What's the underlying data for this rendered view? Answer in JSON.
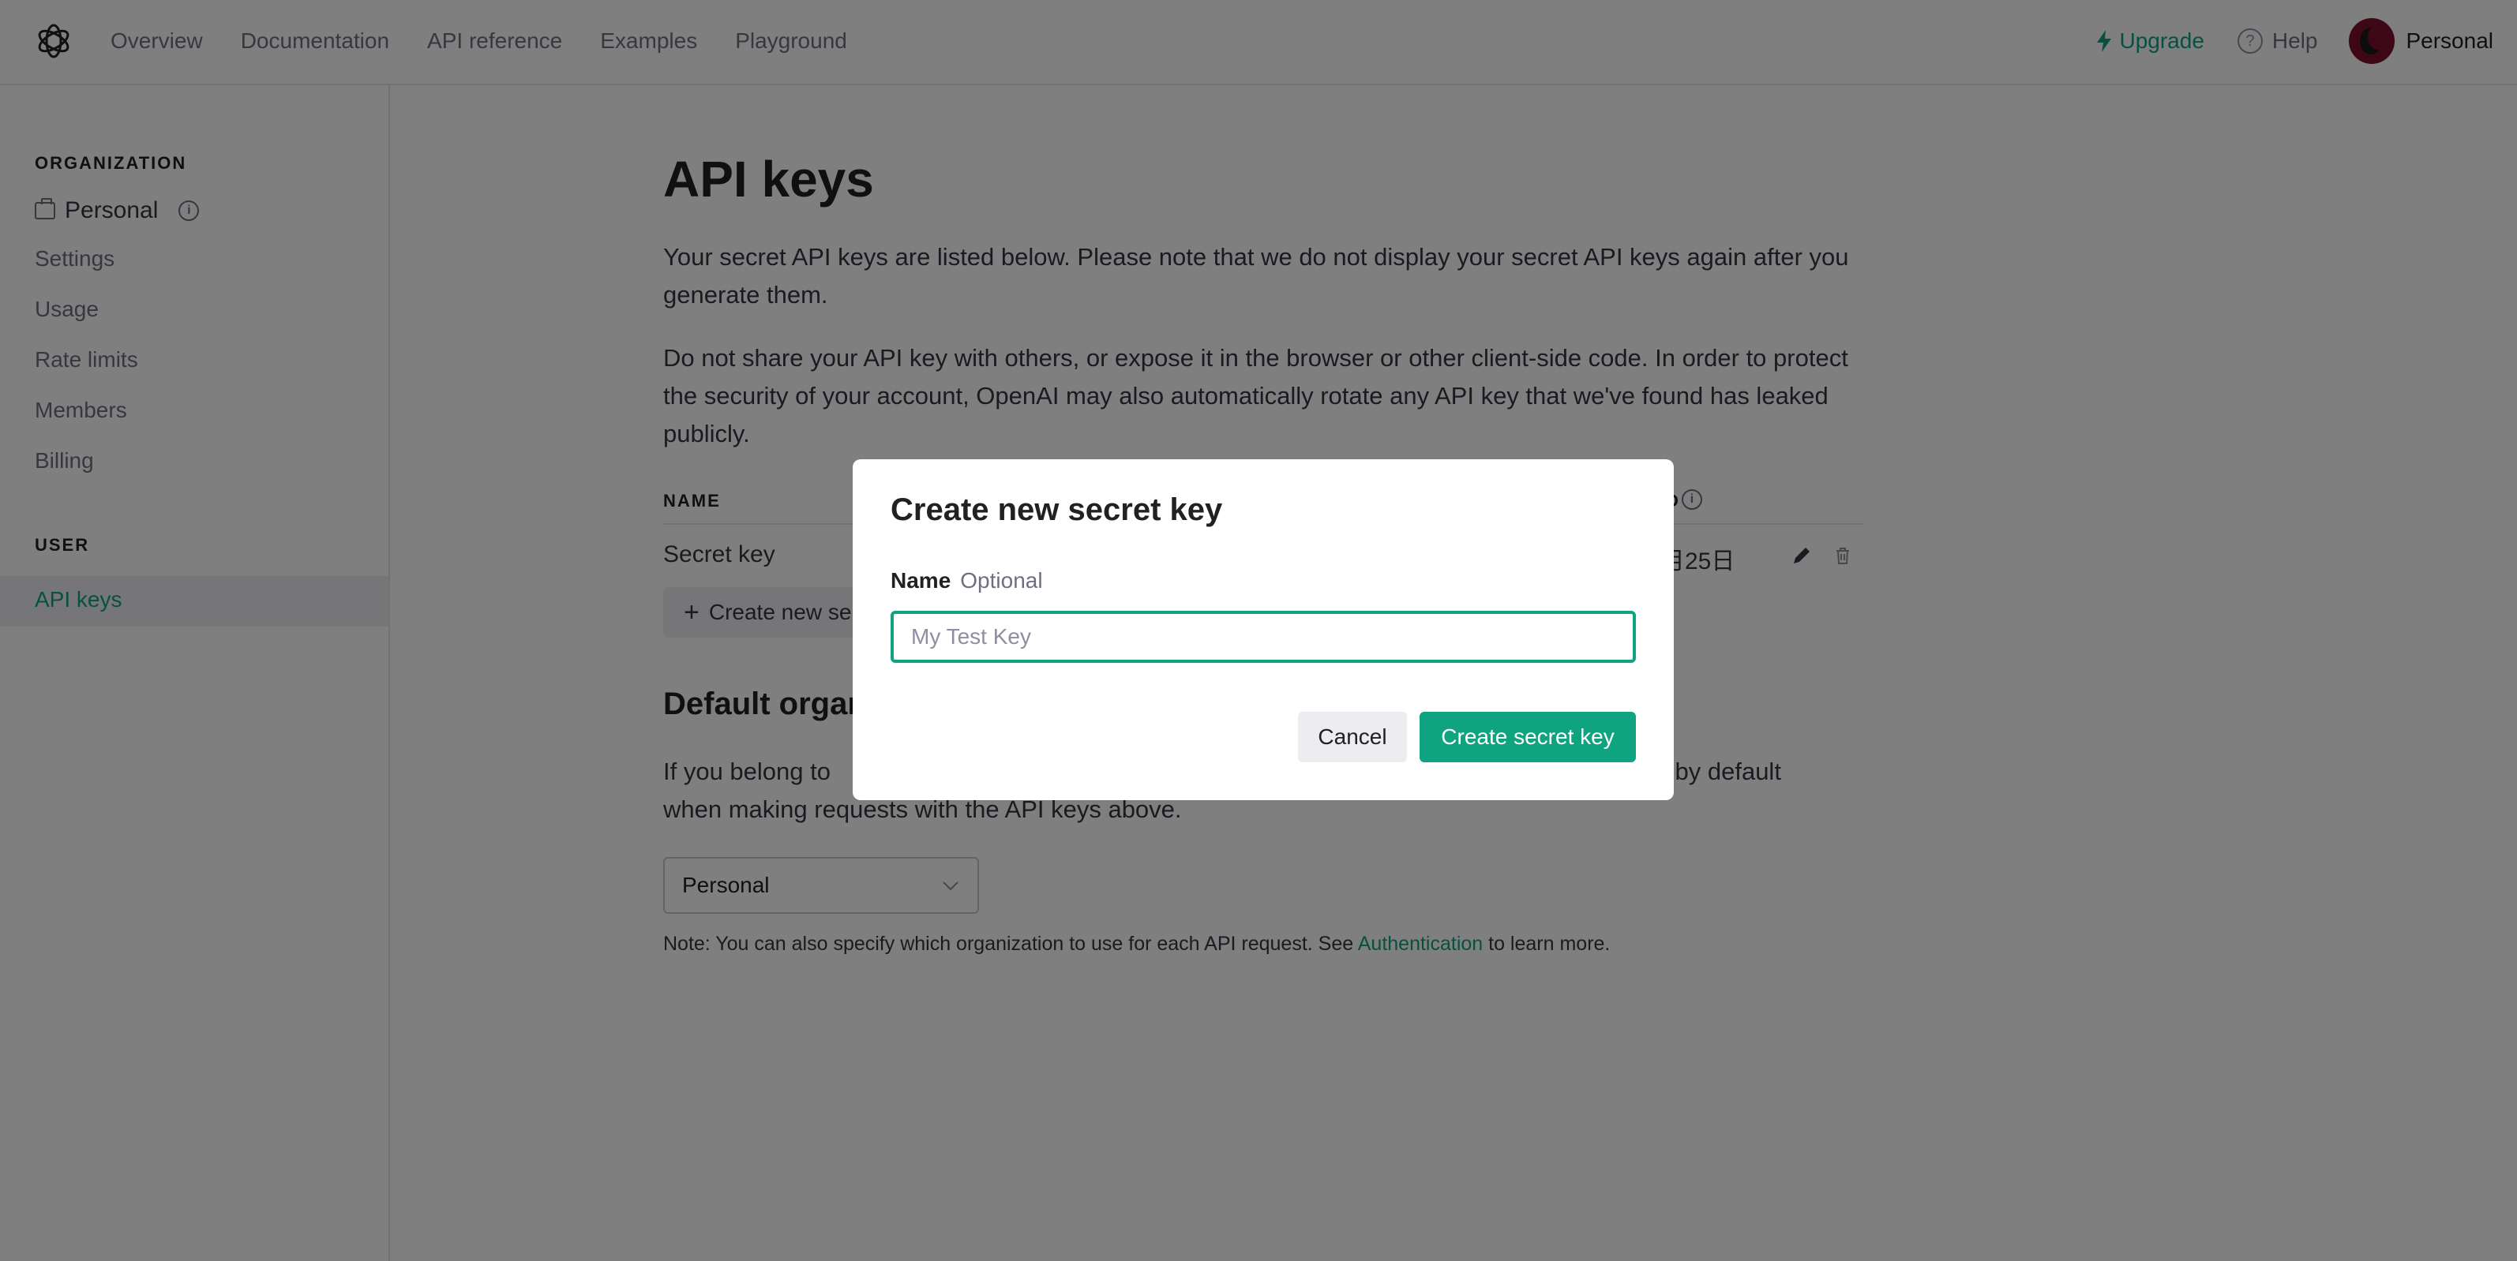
{
  "topnav": {
    "links": [
      "Overview",
      "Documentation",
      "API reference",
      "Examples",
      "Playground"
    ],
    "upgrade": "Upgrade",
    "help": "Help",
    "account": "Personal"
  },
  "sidebar": {
    "organization_label": "ORGANIZATION",
    "org_name": "Personal",
    "org_items": [
      "Settings",
      "Usage",
      "Rate limits",
      "Members",
      "Billing"
    ],
    "user_label": "USER",
    "active_item": "API keys"
  },
  "main": {
    "title": "API keys",
    "para1": "Your secret API keys are listed below. Please note that we do not display your secret API keys again after you generate them.",
    "para2": "Do not share your API key with others, or expose it in the browser or other client-side code. In order to protect the security of your account, OpenAI may also automatically rotate any API key that we've found has leaked publicly.",
    "table": {
      "col_name": "NAME",
      "col_partial": "D",
      "row_name": "Secret key",
      "row_date_partial": "月25日"
    },
    "create_button": "Create new se",
    "section_title": "Default organ",
    "para3_left": "If you belong to",
    "para3_right": "l by default",
    "para3_line2": "when making requests with the API keys above.",
    "select_value": "Personal",
    "note_prefix": "Note: You can also specify which organization to use for each API request. See ",
    "note_link": "Authentication",
    "note_suffix": " to learn more."
  },
  "modal": {
    "title": "Create new secret key",
    "field_label": "Name",
    "field_optional": "Optional",
    "input_placeholder": "My Test Key",
    "input_value": "",
    "cancel": "Cancel",
    "create": "Create secret key"
  },
  "colors": {
    "accent": "#10a37f",
    "overlay": "rgba(0,0,0,0.5)"
  }
}
